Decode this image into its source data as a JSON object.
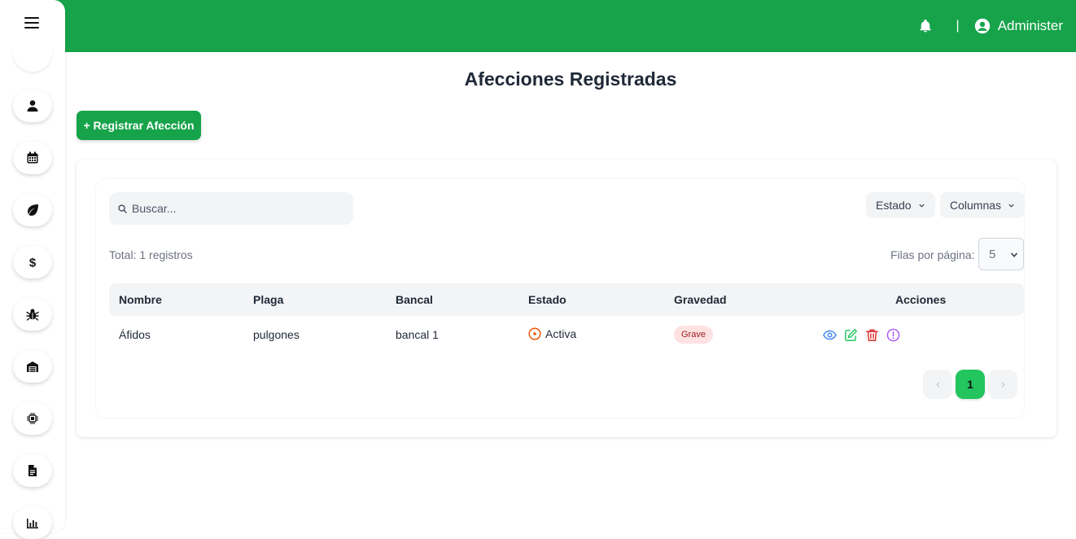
{
  "header": {
    "user_name": "Administer",
    "separator": "|",
    "icons": {
      "notifications": "bell-icon",
      "user": "user-circle-icon"
    }
  },
  "sidebar": {
    "items": [
      {
        "name": "user",
        "icon": "user-icon"
      },
      {
        "name": "calendar",
        "icon": "calendar-icon"
      },
      {
        "name": "crops",
        "icon": "leaf-icon"
      },
      {
        "name": "finance",
        "icon": "dollar-icon"
      },
      {
        "name": "pests",
        "icon": "bug-icon"
      },
      {
        "name": "warehouse",
        "icon": "warehouse-icon"
      },
      {
        "name": "sensors",
        "icon": "microchip-icon"
      },
      {
        "name": "documents",
        "icon": "document-icon"
      },
      {
        "name": "reports",
        "icon": "chart-icon"
      }
    ]
  },
  "page": {
    "title": "Afecciones Registradas",
    "add_button": "+ Registrar Afección"
  },
  "table_controls": {
    "search_placeholder": "Buscar...",
    "estado_filter": "Estado",
    "columns_filter": "Columnas",
    "total": "Total: 1 registros",
    "rows_per_page_label": "Filas por página:",
    "rows_per_page_value": "5"
  },
  "table": {
    "headers": [
      "Nombre",
      "Plaga",
      "Bancal",
      "Estado",
      "Gravedad",
      "Acciones"
    ],
    "rows": [
      {
        "nombre": "Áfidos",
        "plaga": "pulgones",
        "bancal": "bancal 1",
        "estado": "Activa",
        "gravedad": "Grave"
      }
    ],
    "actions": [
      "eye-icon",
      "edit-icon",
      "trash-icon",
      "alert-circle-icon"
    ]
  },
  "pagination": {
    "current": "1",
    "prev": "chevron-left-icon",
    "next": "chevron-right-icon"
  },
  "colors": {
    "brand": "#16a34a",
    "page_active": "#22c55e",
    "estado_activa": "#ea580c",
    "badge_bg": "#fee2e2",
    "badge_text": "#991b1b",
    "view": "#3b82f6",
    "edit": "#22c55e",
    "delete": "#dc2626",
    "alert": "#a855f7"
  }
}
